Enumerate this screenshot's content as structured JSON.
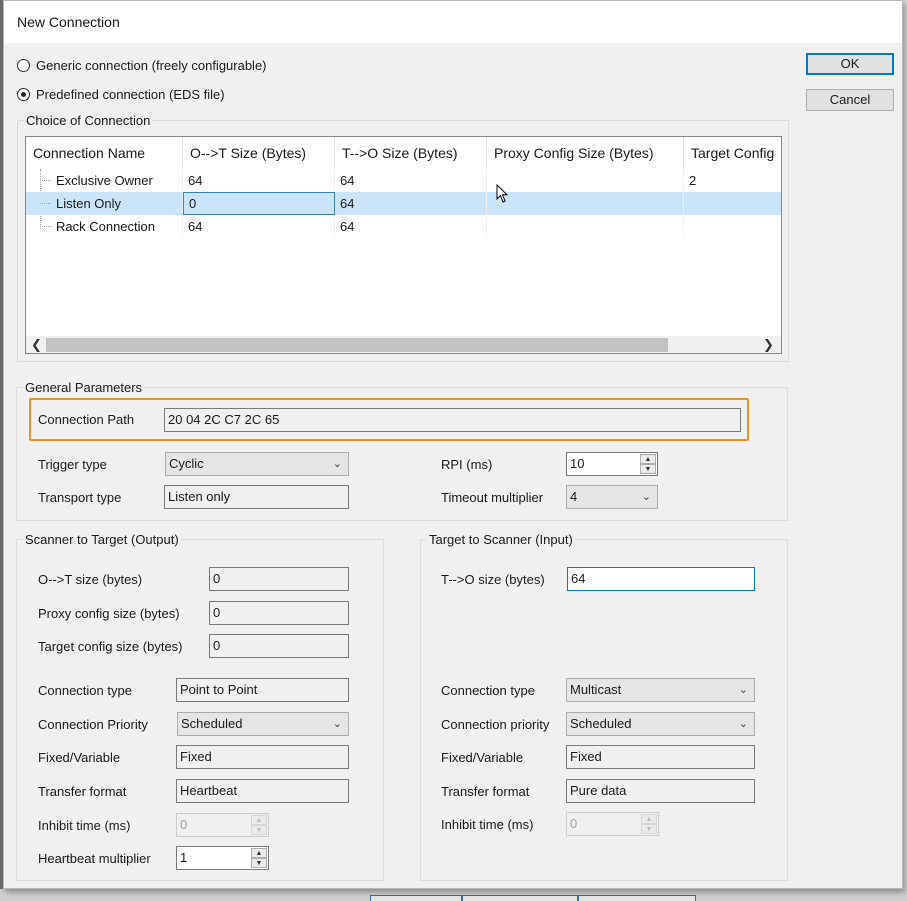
{
  "window": {
    "title": "New Connection"
  },
  "options": {
    "generic_label": "Generic connection (freely configurable)",
    "predefined_label": "Predefined connection (EDS file)",
    "selected": "predefined"
  },
  "buttons": {
    "ok": "OK",
    "cancel": "Cancel"
  },
  "choice": {
    "title": "Choice of Connection",
    "columns": [
      "Connection Name",
      "O-->T Size (Bytes)",
      "T-->O Size (Bytes)",
      "Proxy Config Size (Bytes)",
      "Target Config"
    ],
    "rows": [
      {
        "name": "Exclusive Owner",
        "ot": "64",
        "to": "64",
        "proxy": "",
        "target": "2"
      },
      {
        "name": "Listen Only",
        "ot": "0",
        "to": "64",
        "proxy": "",
        "target": "",
        "selected": true
      },
      {
        "name": "Rack Connection",
        "ot": "64",
        "to": "64",
        "proxy": "",
        "target": ""
      }
    ]
  },
  "general": {
    "title": "General Parameters",
    "connection_path_label": "Connection Path",
    "connection_path": "20 04 2C C7 2C 65",
    "trigger_type_label": "Trigger type",
    "trigger_type": "Cyclic",
    "transport_type_label": "Transport type",
    "transport_type": "Listen only",
    "rpi_label": "RPI (ms)",
    "rpi": "10",
    "timeout_label": "Timeout multiplier",
    "timeout": "4"
  },
  "output": {
    "title": "Scanner to Target (Output)",
    "ot_size_label": "O-->T size (bytes)",
    "ot_size": "0",
    "proxy_label": "Proxy config size (bytes)",
    "proxy": "0",
    "target_label": "Target config size (bytes)",
    "target": "0",
    "conn_type_label": "Connection type",
    "conn_type": "Point to Point",
    "priority_label": "Connection Priority",
    "priority": "Scheduled",
    "fixed_label": "Fixed/Variable",
    "fixed": "Fixed",
    "transfer_label": "Transfer format",
    "transfer": "Heartbeat",
    "inhibit_label": "Inhibit time (ms)",
    "inhibit": "0",
    "heartbeat_label": "Heartbeat multiplier",
    "heartbeat": "1"
  },
  "input": {
    "title": "Target to Scanner (Input)",
    "to_size_label": "T-->O size (bytes)",
    "to_size": "64",
    "conn_type_label": "Connection type",
    "conn_type": "Multicast",
    "priority_label": "Connection priority",
    "priority": "Scheduled",
    "fixed_label": "Fixed/Variable",
    "fixed": "Fixed",
    "transfer_label": "Transfer format",
    "transfer": "Pure data",
    "inhibit_label": "Inhibit time (ms)",
    "inhibit": "0"
  },
  "icons": {
    "chevron": "chevron-down-icon",
    "cursor": "mouse-pointer-icon"
  },
  "colors": {
    "selection": "#cce4f7",
    "highlight": "#e8922c",
    "focus": "#0078d7"
  }
}
